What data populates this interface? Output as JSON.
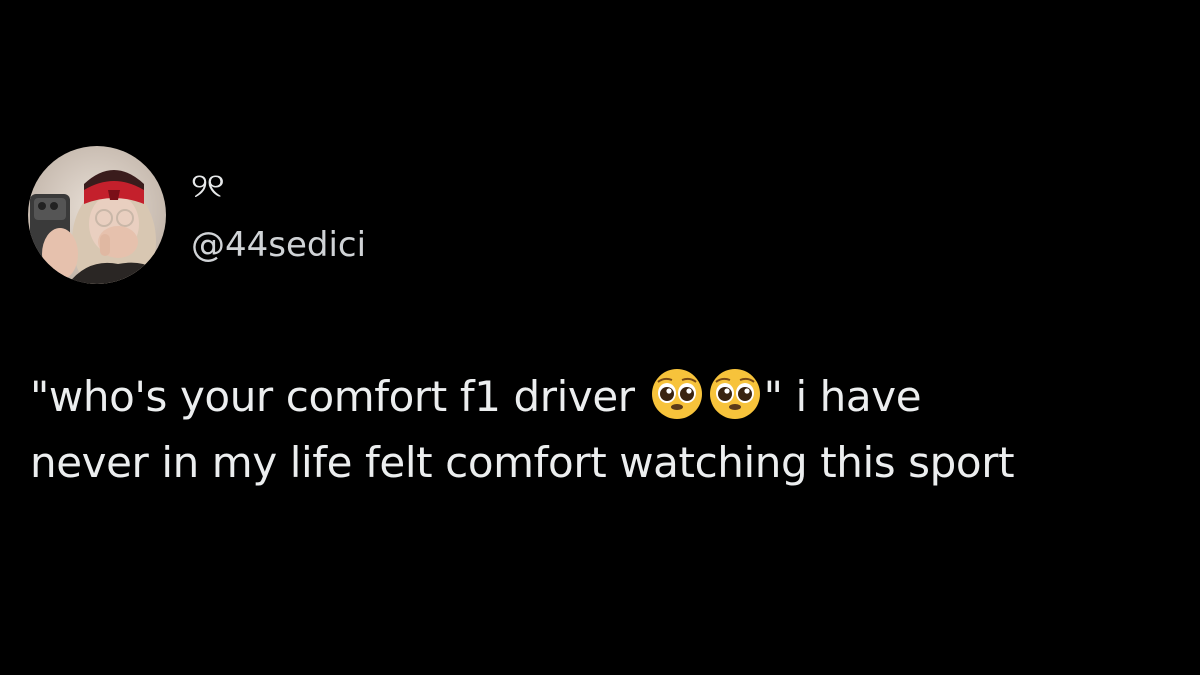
{
  "author": {
    "display_name": "୨୧",
    "handle": "@44sedici",
    "avatar_icon": "profile-photo-avatar"
  },
  "tweet": {
    "line1_start": "\"who's your comfort f1 driver",
    "emoji_1": "pleading-face-emoji",
    "emoji_2": "pleading-face-emoji",
    "line1_end": "\" i have",
    "line2": "never in my life felt comfort watching this sport"
  },
  "colors": {
    "background": "#000000",
    "text_primary": "#e7e9ea",
    "emoji_face": "#f7c33b"
  }
}
